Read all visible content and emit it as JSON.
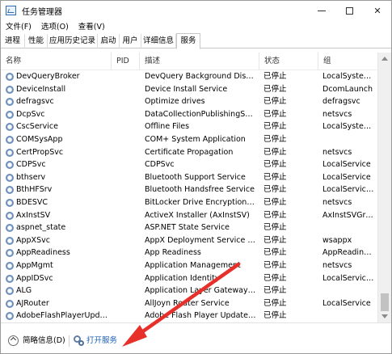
{
  "window": {
    "title": "任务管理器"
  },
  "colors": {
    "accent": "#1a5fb4",
    "annotation_arrow": "#e8302a"
  },
  "menu": [
    "文件(F)",
    "选项(O)",
    "查看(V)"
  ],
  "tabs": [
    {
      "label": "进程",
      "active": false
    },
    {
      "label": "性能",
      "active": false
    },
    {
      "label": "应用历史记录",
      "active": false
    },
    {
      "label": "启动",
      "active": false
    },
    {
      "label": "用户",
      "active": false
    },
    {
      "label": "详细信息",
      "active": false
    },
    {
      "label": "服务",
      "active": true
    }
  ],
  "columns": {
    "name": "名称",
    "pid": "PID",
    "desc": "描述",
    "status": "状态",
    "group": "组"
  },
  "rows": [
    {
      "name": "DevQueryBroker",
      "pid": "",
      "desc": "DevQuery Background Disco...",
      "status": "已停止",
      "group": "LocalSystem..."
    },
    {
      "name": "DeviceInstall",
      "pid": "",
      "desc": "Device Install Service",
      "status": "已停止",
      "group": "DcomLaunch"
    },
    {
      "name": "defragsvc",
      "pid": "",
      "desc": "Optimize drives",
      "status": "已停止",
      "group": "defragsvc"
    },
    {
      "name": "DcpSvc",
      "pid": "",
      "desc": "DataCollectionPublishingServi...",
      "status": "已停止",
      "group": "netsvcs"
    },
    {
      "name": "CscService",
      "pid": "",
      "desc": "Offline Files",
      "status": "已停止",
      "group": "LocalSystem..."
    },
    {
      "name": "COMSysApp",
      "pid": "",
      "desc": "COM+ System Application",
      "status": "已停止",
      "group": ""
    },
    {
      "name": "CertPropSvc",
      "pid": "",
      "desc": "Certificate Propagation",
      "status": "已停止",
      "group": "netsvcs"
    },
    {
      "name": "CDPSvc",
      "pid": "",
      "desc": "CDPSvc",
      "status": "已停止",
      "group": "LocalService"
    },
    {
      "name": "bthserv",
      "pid": "",
      "desc": "Bluetooth Support Service",
      "status": "已停止",
      "group": "LocalService"
    },
    {
      "name": "BthHFSrv",
      "pid": "",
      "desc": "Bluetooth Handsfree Service",
      "status": "已停止",
      "group": "LocalService..."
    },
    {
      "name": "BDESVC",
      "pid": "",
      "desc": "BitLocker Drive Encryption Se...",
      "status": "已停止",
      "group": "netsvcs"
    },
    {
      "name": "AxInstSV",
      "pid": "",
      "desc": "ActiveX Installer (AxInstSV)",
      "status": "已停止",
      "group": "AxInstSVGro..."
    },
    {
      "name": "aspnet_state",
      "pid": "",
      "desc": "ASP.NET State Service",
      "status": "已停止",
      "group": ""
    },
    {
      "name": "AppXSvc",
      "pid": "",
      "desc": "AppX Deployment Service (A...",
      "status": "已停止",
      "group": "wsappx"
    },
    {
      "name": "AppReadiness",
      "pid": "",
      "desc": "App Readiness",
      "status": "已停止",
      "group": "AppReadiness"
    },
    {
      "name": "AppMgmt",
      "pid": "",
      "desc": "Application Management",
      "status": "已停止",
      "group": "netsvcs"
    },
    {
      "name": "AppIDSvc",
      "pid": "",
      "desc": "Application Identity",
      "status": "已停止",
      "group": "LocalService..."
    },
    {
      "name": "ALG",
      "pid": "",
      "desc": "Application Layer Gateway Se...",
      "status": "已停止",
      "group": ""
    },
    {
      "name": "AJRouter",
      "pid": "",
      "desc": "AllJoyn Router Service",
      "status": "已停止",
      "group": "LocalService"
    },
    {
      "name": "AdobeFlashPlayerUpdat...",
      "pid": "",
      "desc": "Adobe Flash Player Update S...",
      "status": "已停止",
      "group": ""
    }
  ],
  "footer": {
    "brief_label": "简略信息(D)",
    "open_services_label": "打开服务"
  }
}
